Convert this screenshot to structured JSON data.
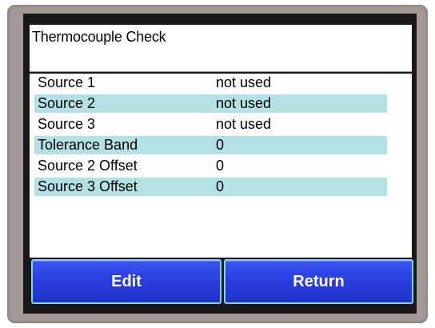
{
  "screen": {
    "title": "Thermocouple Check"
  },
  "rows": [
    {
      "label": "Source 1",
      "value": "not used"
    },
    {
      "label": "Source 2",
      "value": "not used"
    },
    {
      "label": "Source 3",
      "value": "not used"
    },
    {
      "label": "Tolerance Band",
      "value": "0"
    },
    {
      "label": "Source 2 Offset",
      "value": "0"
    },
    {
      "label": "Source 3 Offset",
      "value": "0"
    }
  ],
  "buttons": {
    "edit_label": "Edit",
    "return_label": "Return"
  },
  "colors": {
    "button_blue": "#2a3ee0",
    "row_highlight": "#b3e1e6",
    "bezel": "#a49996"
  }
}
